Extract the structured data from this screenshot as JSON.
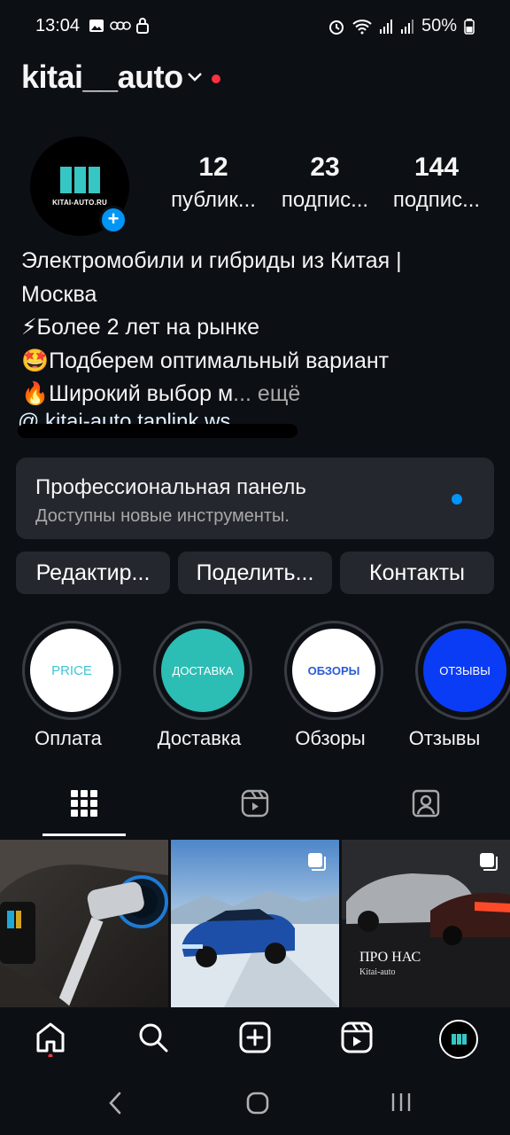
{
  "status": {
    "time": "13:04",
    "battery": "50%"
  },
  "profile": {
    "username": "kitai__auto",
    "avatar_text": "KITAI-AUTO.RU",
    "stats": [
      {
        "value": "12",
        "label": "публик..."
      },
      {
        "value": "23",
        "label": "подпис..."
      },
      {
        "value": "144",
        "label": "подпис..."
      }
    ],
    "bio_lines": [
      "Электромобили и гибриды из Китая |",
      "Москва",
      "⚡Более 2 лет на рынке",
      "🤩Подберем оптимальный вариант",
      "🔥Широкий выбор м"
    ],
    "bio_more": "... ещё",
    "bio_link": "@ kitai-auto.taplink.ws"
  },
  "pro_panel": {
    "title": "Профессиональная панель",
    "subtitle": "Доступны новые инструменты."
  },
  "buttons": {
    "edit": "Редактир...",
    "share": "Поделить...",
    "contacts": "Контакты"
  },
  "highlights": [
    {
      "label": "Оплата",
      "cover_text": "PRICE",
      "cover_color": "#ffffff",
      "text_color": "#3fc6d4"
    },
    {
      "label": "Доставка",
      "cover_text": "ДОСТАВКА",
      "cover_color": "#2cbdb4",
      "text_color": "#ffffff"
    },
    {
      "label": "Обзоры",
      "cover_text": "ОБЗОРЫ",
      "cover_color": "#ffffff",
      "text_color": "#2a5bd7"
    },
    {
      "label": "Отзывы",
      "cover_text": "ОТЗЫВЫ",
      "cover_color": "#0a3cf5",
      "text_color": "#ffffff"
    }
  ],
  "posts": [
    {
      "title": "",
      "subtitle": "",
      "icon": "charging-photo"
    },
    {
      "title": "",
      "subtitle": "",
      "icon": "blue-car-photo"
    },
    {
      "title": "ПРО НАС",
      "subtitle": "Kitai-auto",
      "icon": "cars-photo"
    }
  ],
  "colors": {
    "background": "#0c0f14",
    "panel": "#24272d",
    "accent": "#0095f6",
    "notification": "#ff3040"
  },
  "icons": {
    "tabs": [
      "grid-icon",
      "reels-icon",
      "tagged-icon"
    ],
    "nav": [
      "home-icon",
      "search-icon",
      "create-icon",
      "reels-icon",
      "profile-icon"
    ]
  }
}
